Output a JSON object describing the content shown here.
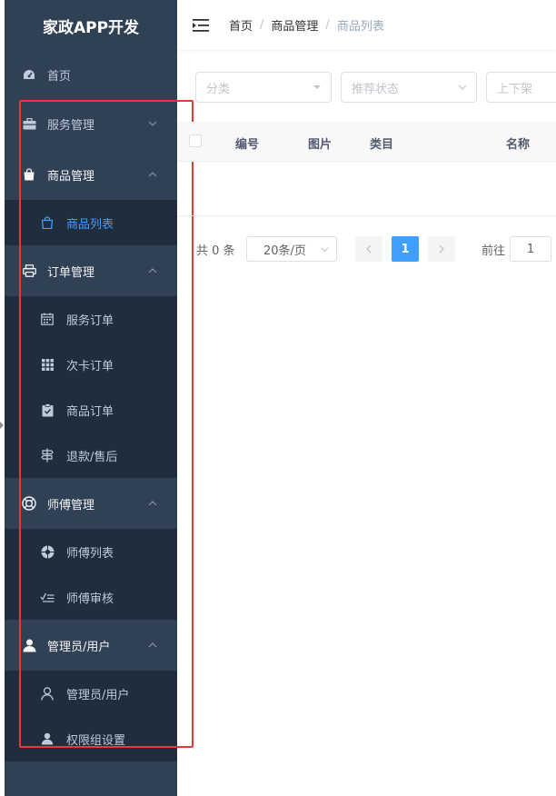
{
  "sidebar": {
    "title": "家政APP开发",
    "home": "首页",
    "groups": [
      {
        "label": "服务管理",
        "icon": "briefcase-icon"
      },
      {
        "label": "商品管理",
        "icon": "shopping-bag-icon",
        "children": [
          {
            "label": "商品列表",
            "icon": "shopping-bag-outline-icon"
          }
        ]
      },
      {
        "label": "订单管理",
        "icon": "printer-icon",
        "children": [
          {
            "label": "服务订单",
            "icon": "calendar-icon"
          },
          {
            "label": "次卡订单",
            "icon": "grid-icon"
          },
          {
            "label": "商品订单",
            "icon": "clipboard-check-icon"
          },
          {
            "label": "退款/售后",
            "icon": "signpost-icon"
          }
        ]
      },
      {
        "label": "师傅管理",
        "icon": "lifebuoy-icon",
        "children": [
          {
            "label": "师傅列表",
            "icon": "aperture-icon"
          },
          {
            "label": "师傅审核",
            "icon": "check-list-icon"
          }
        ]
      },
      {
        "label": "管理员/用户",
        "icon": "user-filled-icon",
        "children": [
          {
            "label": "管理员/用户",
            "icon": "user-outline-icon"
          },
          {
            "label": "权限组设置",
            "icon": "user-filled-small-icon"
          }
        ]
      }
    ]
  },
  "header": {
    "breadcrumb": [
      "首页",
      "商品管理",
      "商品列表"
    ]
  },
  "filters": {
    "category_placeholder": "分类",
    "recommend_placeholder": "推荐状态",
    "shelf_placeholder": "上下架"
  },
  "table": {
    "columns": [
      "编号",
      "图片",
      "类目",
      "名称"
    ]
  },
  "pagination": {
    "total": "共 0 条",
    "page_size": "20条/页",
    "current_page": "1",
    "goto_label": "前往",
    "goto_value": "1"
  },
  "colors": {
    "sidebar_bg": "#304156",
    "submenu_bg": "#1f2d3d",
    "accent": "#409eff",
    "highlight_box": "#e53935"
  }
}
